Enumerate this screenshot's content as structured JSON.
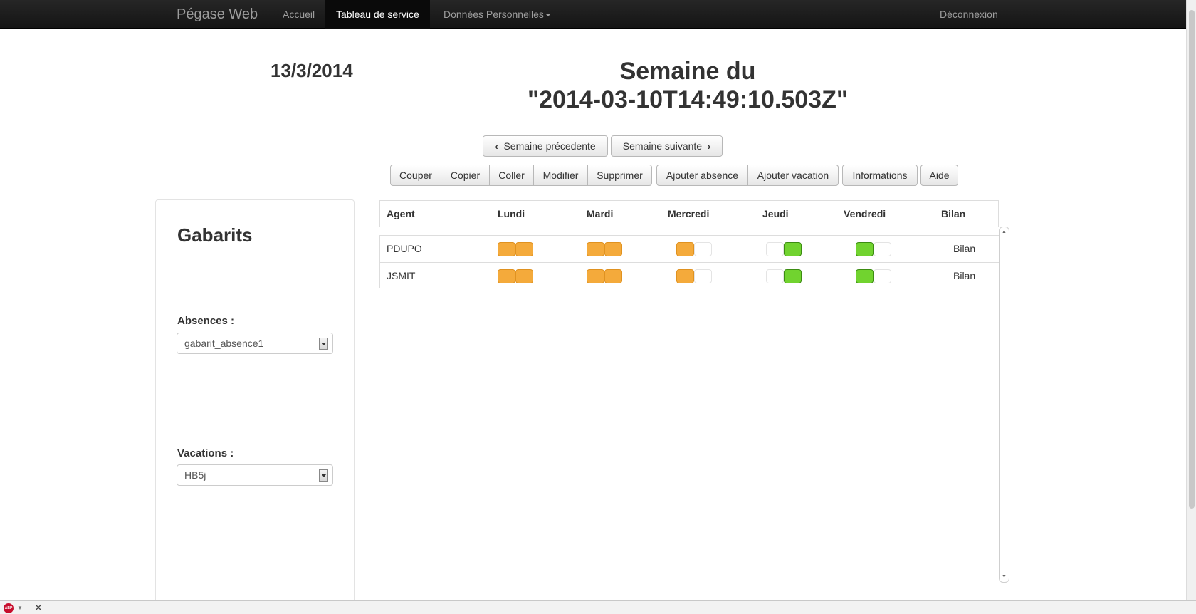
{
  "navbar": {
    "brand": "Pégase Web",
    "items": [
      {
        "label": "Accueil"
      },
      {
        "label": "Tableau de service"
      },
      {
        "label": "Données Personnelles"
      }
    ],
    "logout": "Déconnexion"
  },
  "header": {
    "date": "13/3/2014",
    "week_title_line1": "Semaine du",
    "week_title_line2": "\"2014-03-10T14:49:10.503Z\""
  },
  "week_nav": {
    "prev": "Semaine précedente",
    "next": "Semaine suivante"
  },
  "toolbar": {
    "cut": "Couper",
    "copy": "Copier",
    "paste": "Coller",
    "modify": "Modifier",
    "delete": "Supprimer",
    "add_absence": "Ajouter absence",
    "add_vacation": "Ajouter vacation",
    "info": "Informations",
    "help": "Aide"
  },
  "gabarits": {
    "title": "Gabarits",
    "absences_label": "Absences :",
    "absences_value": "gabarit_absence1",
    "vacations_label": "Vacations :",
    "vacations_value": "HB5j"
  },
  "table": {
    "headers": [
      "Agent",
      "Lundi",
      "Mardi",
      "Mercredi",
      "Jeudi",
      "Vendredi",
      "Bilan"
    ],
    "rows": [
      {
        "agent": "PDUPO",
        "slots": [
          [
            "orange",
            "orange"
          ],
          [
            "orange",
            "orange"
          ],
          [
            "orange",
            "empty"
          ],
          [
            "empty",
            "green"
          ],
          [
            "green",
            "empty"
          ]
        ],
        "bilan": "Bilan"
      },
      {
        "agent": "JSMIT",
        "slots": [
          [
            "orange",
            "orange"
          ],
          [
            "orange",
            "orange"
          ],
          [
            "orange",
            "empty"
          ],
          [
            "empty",
            "green"
          ],
          [
            "green",
            "empty"
          ]
        ],
        "bilan": "Bilan"
      }
    ]
  },
  "colors": {
    "navbar": "#1b1b1b",
    "slot_orange": "#f4aa3b",
    "slot_green": "#71d32f"
  },
  "addon_bar": {
    "adblock_icon": "ABP"
  }
}
